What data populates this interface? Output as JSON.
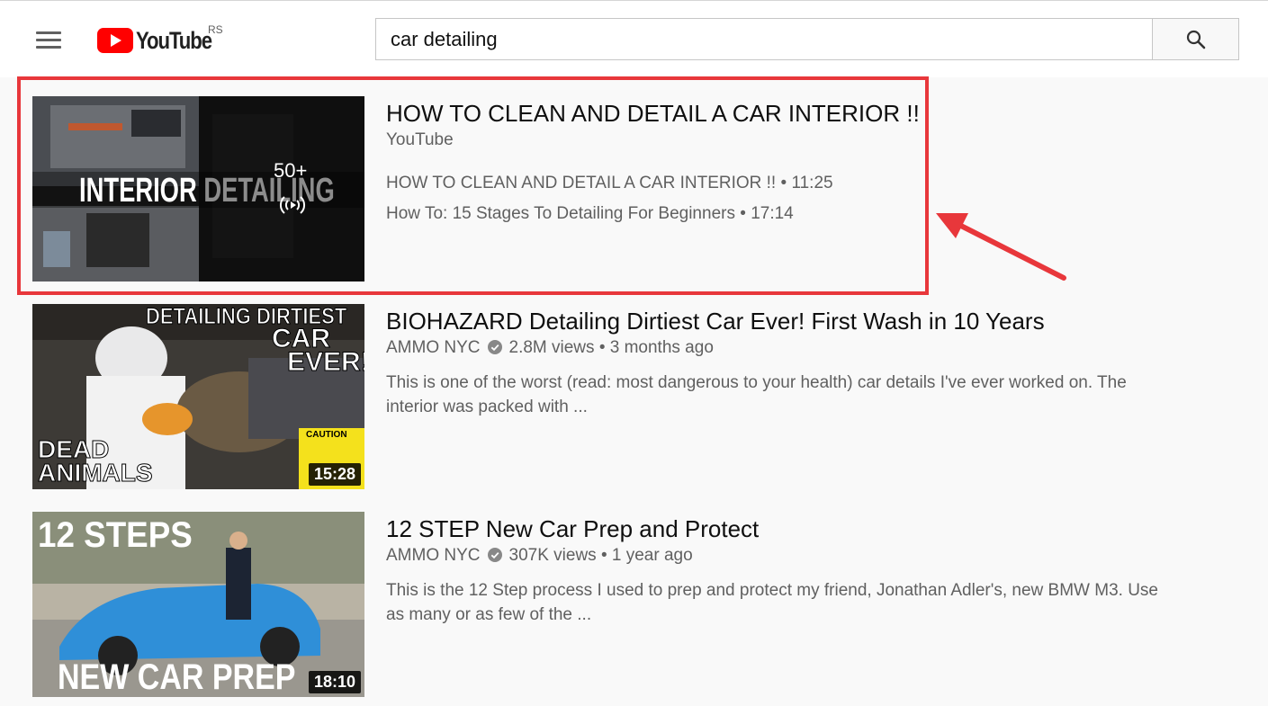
{
  "header": {
    "logo_text": "YouTube",
    "country_code": "RS",
    "search_value": "car detailing",
    "search_placeholder": "Search"
  },
  "results": [
    {
      "type": "playlist",
      "title": "HOW TO CLEAN AND DETAIL A CAR INTERIOR !!",
      "channel": "YouTube",
      "thumbnail_text": "INTERIOR DETAILING",
      "video_count": "50+",
      "playlist_items": [
        {
          "title": "HOW TO CLEAN AND DETAIL A CAR INTERIOR !!",
          "sep": "•",
          "duration": "11:25"
        },
        {
          "title": "How To: 15 Stages To Detailing For Beginners",
          "sep": "•",
          "duration": "17:14"
        }
      ]
    },
    {
      "type": "video",
      "title": "BIOHAZARD Detailing Dirtiest Car Ever! First Wash in 10 Years",
      "channel": "AMMO NYC",
      "views": "2.8M views",
      "sep": "•",
      "age": "3 months ago",
      "description": "This is one of the worst (read: most dangerous to your health) car details I've ever worked on. The interior was packed with ...",
      "thumb_top": "DETAILING DIRTIEST",
      "thumb_car": "CAR",
      "thumb_ever": "EVER!",
      "thumb_bottom1": "DEAD",
      "thumb_bottom2": "ANIMALS",
      "thumb_caution": "CAUTION",
      "duration": "15:28"
    },
    {
      "type": "video",
      "title": "12 STEP New Car Prep and Protect",
      "channel": "AMMO NYC",
      "views": "307K views",
      "sep": "•",
      "age": "1 year ago",
      "description": "This is the 12 Step process I used to prep and protect my friend, Jonathan Adler's, new BMW M3. Use as many or as few of the ...",
      "thumb_top": "12 STEPS",
      "thumb_bottom": "NEW CAR PREP",
      "duration": "18:10"
    }
  ],
  "colors": {
    "annotation": "#e8373b",
    "brand_red": "#ff0000",
    "background": "#f9f9f9"
  },
  "icons": [
    "menu-icon",
    "youtube-logo",
    "search-icon",
    "verified-icon",
    "live-broadcast-icon",
    "annotation-arrow"
  ]
}
